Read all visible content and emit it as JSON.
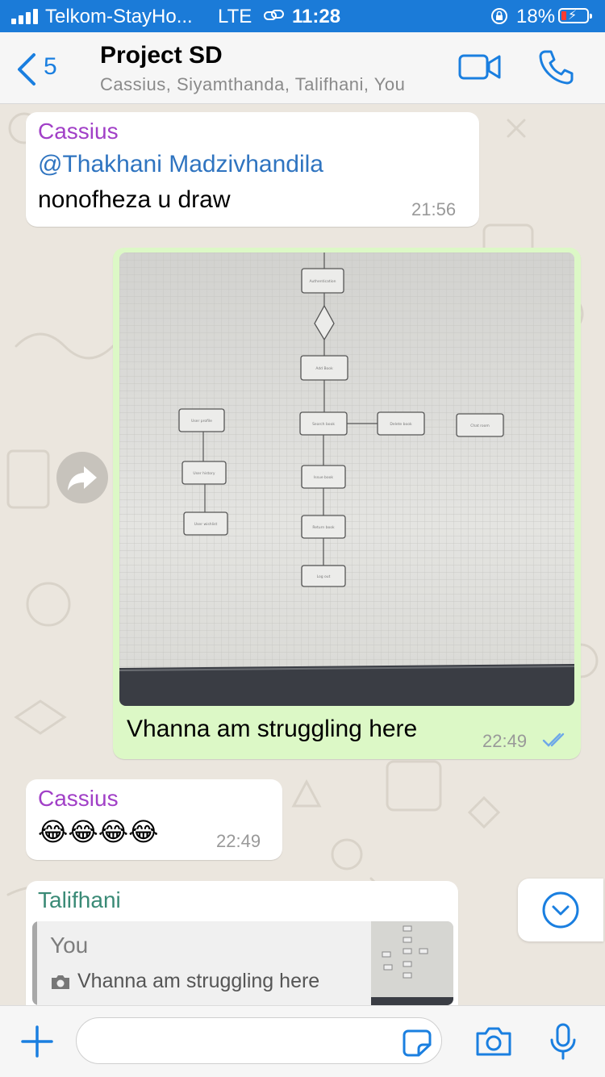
{
  "status_bar": {
    "carrier": "Telkom-StayHo...",
    "network": "LTE",
    "time": "11:28",
    "battery_percent": "18%",
    "battery_level": 0.18,
    "icons": [
      "signal-icon",
      "link-icon",
      "orientation-lock-icon",
      "battery-charging-icon"
    ]
  },
  "header": {
    "back_count": "5",
    "title": "Project SD",
    "subtitle": "Cassius, Siyamthanda, Talifhani, You",
    "icons": [
      "chevron-left-icon",
      "video-call-icon",
      "phone-icon"
    ]
  },
  "messages": [
    {
      "sender": "Cassius",
      "mention": "@Thakhani Madzivhandila",
      "text": "nonofheza u draw",
      "time": "21:56"
    },
    {
      "type": "image",
      "caption": "Vhanna am struggling here",
      "time": "22:49",
      "status": "read",
      "diagram_labels": [
        "Authentication",
        "Add Book",
        "Search book",
        "Delete book",
        "Chat room",
        "User profile",
        "User history",
        "User wishlist",
        "Issue book",
        "Return book",
        "Log out"
      ]
    },
    {
      "sender": "Cassius",
      "text": "😂😂😂😂",
      "time": "22:49"
    },
    {
      "sender": "Talifhani",
      "quote_author": "You",
      "quote_text": "Vhanna am struggling here"
    }
  ],
  "input": {
    "placeholder": "",
    "icons": [
      "plus-icon",
      "sticker-icon",
      "camera-icon",
      "microphone-icon"
    ]
  },
  "colors": {
    "accent": "#1a7fe0",
    "status_bar_bg": "#1b7bd8",
    "outgoing_bubble": "#dcf8c6",
    "cassius_name": "#a140c7",
    "talifhani_name": "#3a8a76"
  }
}
